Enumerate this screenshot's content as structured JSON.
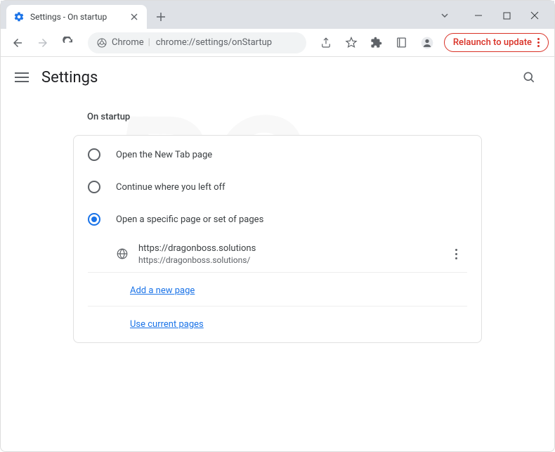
{
  "window": {
    "tab_title": "Settings - On startup"
  },
  "toolbar": {
    "origin_label": "Chrome",
    "url": "chrome://settings/onStartup",
    "relaunch_label": "Relaunch to update"
  },
  "header": {
    "title": "Settings"
  },
  "section": {
    "heading": "On startup",
    "options": [
      {
        "label": "Open the New Tab page",
        "selected": false
      },
      {
        "label": "Continue where you left off",
        "selected": false
      },
      {
        "label": "Open a specific page or set of pages",
        "selected": true
      }
    ],
    "pages": [
      {
        "title": "https://dragonboss.solutions",
        "url": "https://dragonboss.solutions/"
      }
    ],
    "add_page_label": "Add a new page",
    "use_current_label": "Use current pages"
  }
}
